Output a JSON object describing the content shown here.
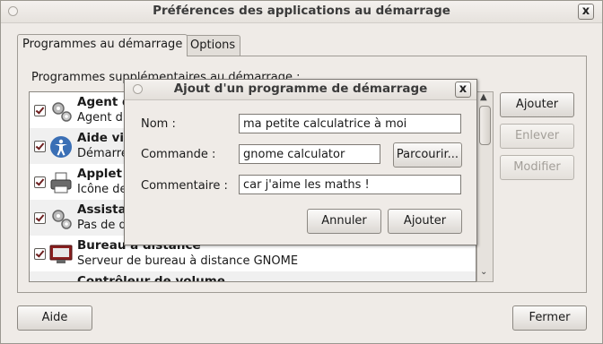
{
  "window": {
    "title": "Préférences des applications au démarrage",
    "close": "x"
  },
  "tabs": [
    {
      "label": "Programmes au démarrage",
      "active": true
    },
    {
      "label": "Options",
      "active": false
    }
  ],
  "section_label": "Programmes supplémentaires au démarrage :",
  "programs": [
    {
      "title": "Agent d",
      "desc": "Agent d'",
      "checked": true,
      "icon": "gears-icon"
    },
    {
      "title": "Aide vis",
      "desc": "Démarre",
      "checked": true,
      "icon": "accessibility-icon"
    },
    {
      "title": "Applet",
      "desc": "Icône de",
      "checked": true,
      "icon": "printer-icon"
    },
    {
      "title": "Assista",
      "desc": "Pas de d",
      "checked": true,
      "icon": "gears-icon"
    },
    {
      "title": "Bureau à distance",
      "desc": "Serveur de bureau à distance GNOME",
      "checked": true,
      "icon": "remote-desktop-icon"
    },
    {
      "title": "Contrôleur de volume",
      "desc": "",
      "checked": true,
      "icon": "volume-icon"
    }
  ],
  "side_buttons": {
    "add": "Ajouter",
    "remove": "Enlever",
    "modify": "Modifier"
  },
  "footer": {
    "help": "Aide",
    "close": "Fermer"
  },
  "dialog": {
    "title": "Ajout d'un programme de démarrage",
    "close": "x",
    "name_label": "Nom :",
    "name_value": "ma petite calculatrice à moi",
    "command_label": "Commande :",
    "command_value": "gnome calculator",
    "browse": "Parcourir...",
    "comment_label": "Commentaire :",
    "comment_value": "car j'aime les maths !",
    "cancel": "Annuler",
    "add": "Ajouter"
  }
}
